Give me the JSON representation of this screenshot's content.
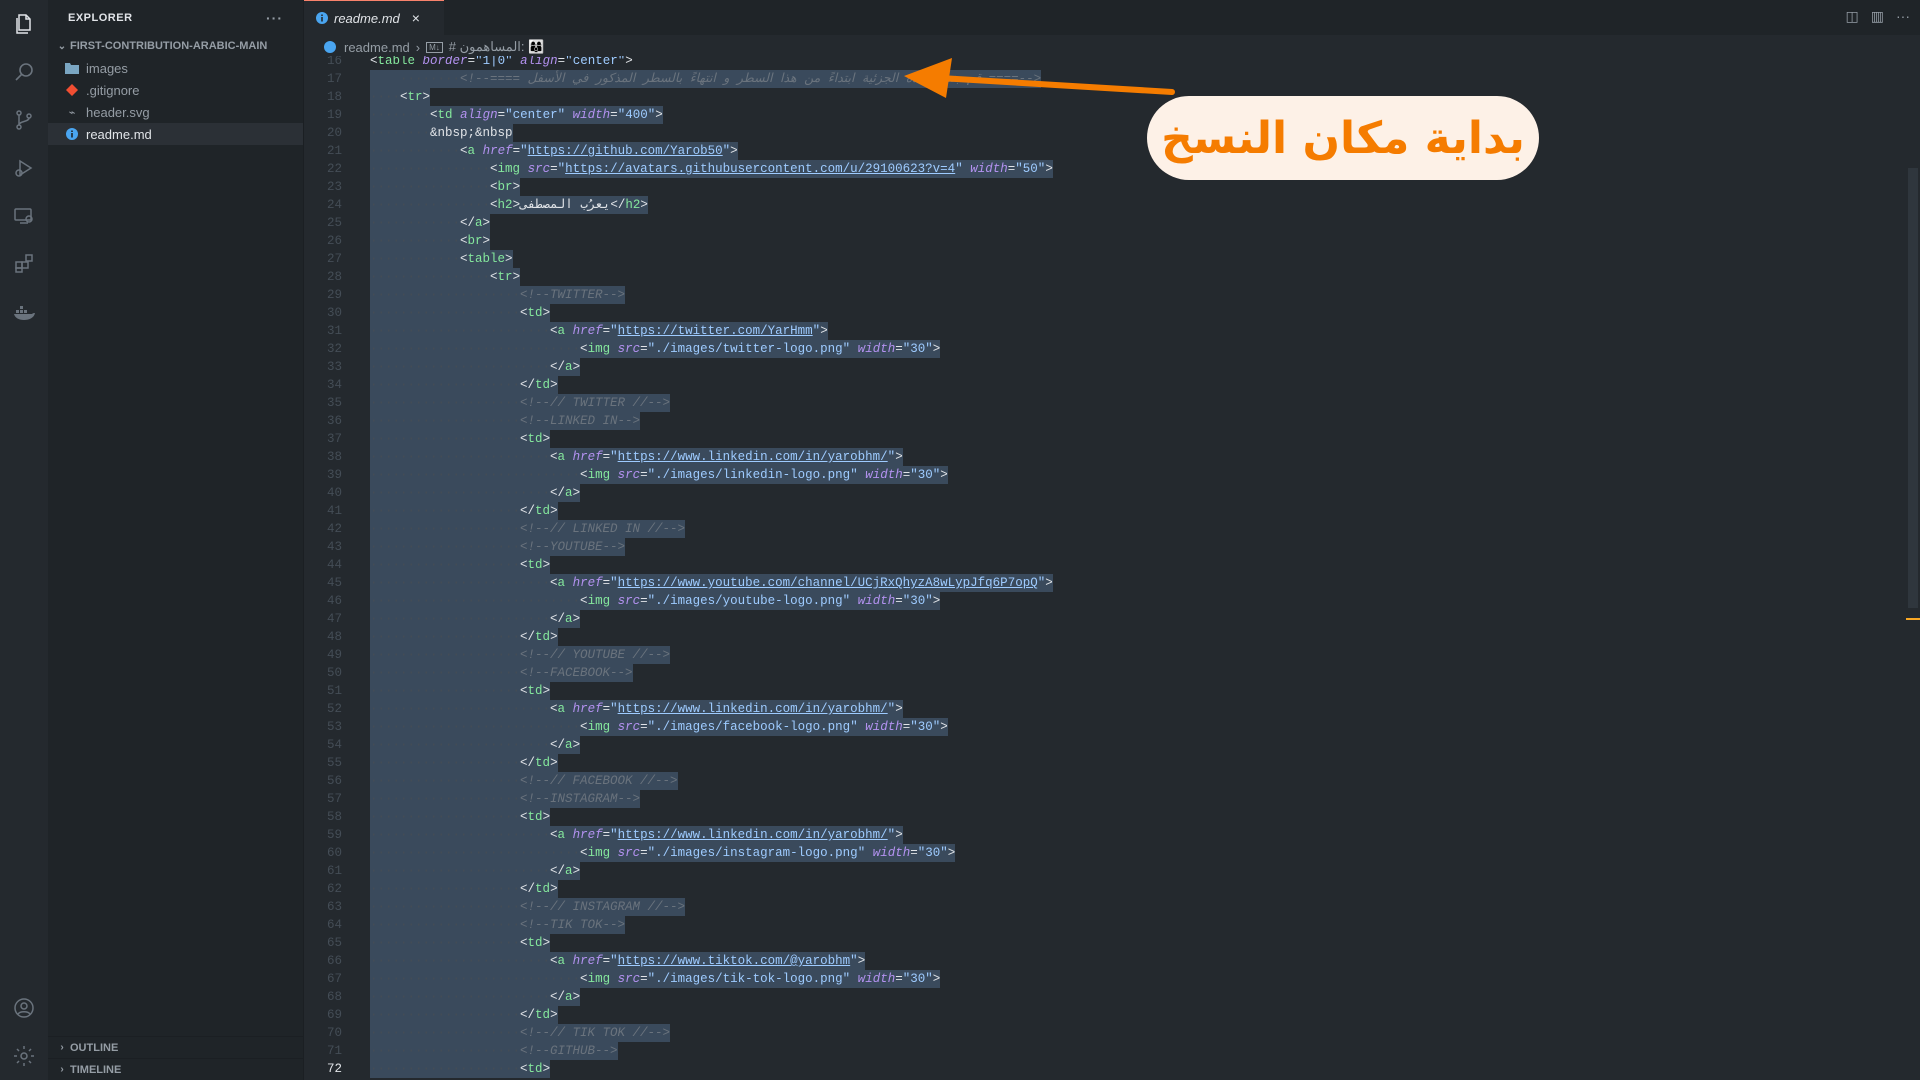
{
  "sidebar": {
    "title": "EXPLORER",
    "folder": "FIRST-CONTRIBUTION-ARABIC-MAIN",
    "files": [
      {
        "name": "images",
        "icon": "folder-icon"
      },
      {
        "name": ".gitignore",
        "icon": "git-icon"
      },
      {
        "name": "header.svg",
        "icon": "svg-file-icon"
      },
      {
        "name": "readme.md",
        "icon": "info-file-icon"
      }
    ],
    "sections": [
      "OUTLINE",
      "TIMELINE"
    ]
  },
  "tab": {
    "label": "readme.md",
    "close": "×"
  },
  "breadcrumb": {
    "file": "readme.md",
    "sep": "›",
    "section": "# المساهمون: 👩‍👩‍👦"
  },
  "callout": {
    "text": "بداية مكان النسخ"
  },
  "colors": {
    "callout_text": "#f57c00",
    "callout_bg": "#fdf1e7",
    "arrow": "#f57c00"
  },
  "code": {
    "lines": [
      {
        "n": "16",
        "t": "<table border=\"1|0\" align=\"center\">"
      },
      {
        "n": "17",
        "t": "<!--==== قم بنسخ هذه الجزئية ابتداءً من هذا السطر و انتهاءً بالسطر المذكور في الأسفل ====-->"
      },
      {
        "n": "18",
        "t": "<tr>"
      },
      {
        "n": "19",
        "t": "<td align=\"center\" width=\"400\">"
      },
      {
        "n": "20",
        "t": "&nbsp;&nbsp"
      },
      {
        "n": "21",
        "t": "<a href=\"https://github.com/Yarob50\">"
      },
      {
        "n": "22",
        "t": "<img src=\"https://avatars.githubusercontent.com/u/29100623?v=4\" width=\"50\">"
      },
      {
        "n": "23",
        "t": "<br>"
      },
      {
        "n": "24",
        "t": "<h2>يعرُب المصطفى</h2>"
      },
      {
        "n": "25",
        "t": "</a>"
      },
      {
        "n": "26",
        "t": "<br>"
      },
      {
        "n": "27",
        "t": "<table>"
      },
      {
        "n": "28",
        "t": "<tr>"
      },
      {
        "n": "29",
        "t": "<!--TWITTER-->"
      },
      {
        "n": "30",
        "t": "<td>"
      },
      {
        "n": "31",
        "t": "<a href=\"https://twitter.com/YarHmm\">"
      },
      {
        "n": "32",
        "t": "<img src=\"./images/twitter-logo.png\" width=\"30\">"
      },
      {
        "n": "33",
        "t": "</a>"
      },
      {
        "n": "34",
        "t": "</td>"
      },
      {
        "n": "35",
        "t": "<!--// TWITTER //-->"
      },
      {
        "n": "36",
        "t": "<!--LINKED IN-->"
      },
      {
        "n": "37",
        "t": "<td>"
      },
      {
        "n": "38",
        "t": "<a href=\"https://www.linkedin.com/in/yarobhm/\">"
      },
      {
        "n": "39",
        "t": "<img src=\"./images/linkedin-logo.png\" width=\"30\">"
      },
      {
        "n": "40",
        "t": "</a>"
      },
      {
        "n": "41",
        "t": "</td>"
      },
      {
        "n": "42",
        "t": "<!--// LINKED IN //-->"
      },
      {
        "n": "43",
        "t": "<!--YOUTUBE-->"
      },
      {
        "n": "44",
        "t": "<td>"
      },
      {
        "n": "45",
        "t": "<a href=\"https://www.youtube.com/channel/UCjRxQhyzA8wLypJfq6P7opQ\">"
      },
      {
        "n": "46",
        "t": "<img src=\"./images/youtube-logo.png\" width=\"30\">"
      },
      {
        "n": "47",
        "t": "</a>"
      },
      {
        "n": "48",
        "t": "</td>"
      },
      {
        "n": "49",
        "t": "<!--// YOUTUBE //-->"
      },
      {
        "n": "50",
        "t": "<!--FACEBOOK-->"
      },
      {
        "n": "51",
        "t": "<td>"
      },
      {
        "n": "52",
        "t": "<a href=\"https://www.linkedin.com/in/yarobhm/\">"
      },
      {
        "n": "53",
        "t": "<img src=\"./images/facebook-logo.png\" width=\"30\">"
      },
      {
        "n": "54",
        "t": "</a>"
      },
      {
        "n": "55",
        "t": "</td>"
      },
      {
        "n": "56",
        "t": "<!--// FACEBOOK //-->"
      },
      {
        "n": "57",
        "t": "<!--INSTAGRAM-->"
      },
      {
        "n": "58",
        "t": "<td>"
      },
      {
        "n": "59",
        "t": "<a href=\"https://www.linkedin.com/in/yarobhm/\">"
      },
      {
        "n": "60",
        "t": "<img src=\"./images/instagram-logo.png\" width=\"30\">"
      },
      {
        "n": "61",
        "t": "</a>"
      },
      {
        "n": "62",
        "t": "</td>"
      },
      {
        "n": "63",
        "t": "<!--// INSTAGRAM //-->"
      },
      {
        "n": "64",
        "t": "<!--TIK TOK-->"
      },
      {
        "n": "65",
        "t": "<td>"
      },
      {
        "n": "66",
        "t": "<a href=\"https://www.tiktok.com/@yarobhm\">"
      },
      {
        "n": "67",
        "t": "<img src=\"./images/tik-tok-logo.png\" width=\"30\">"
      },
      {
        "n": "68",
        "t": "</a>"
      },
      {
        "n": "69",
        "t": "</td>"
      },
      {
        "n": "70",
        "t": "<!--// TIK TOK //-->"
      },
      {
        "n": "71",
        "t": "<!--GITHUB-->"
      },
      {
        "n": "72",
        "t": "<td>"
      }
    ]
  }
}
